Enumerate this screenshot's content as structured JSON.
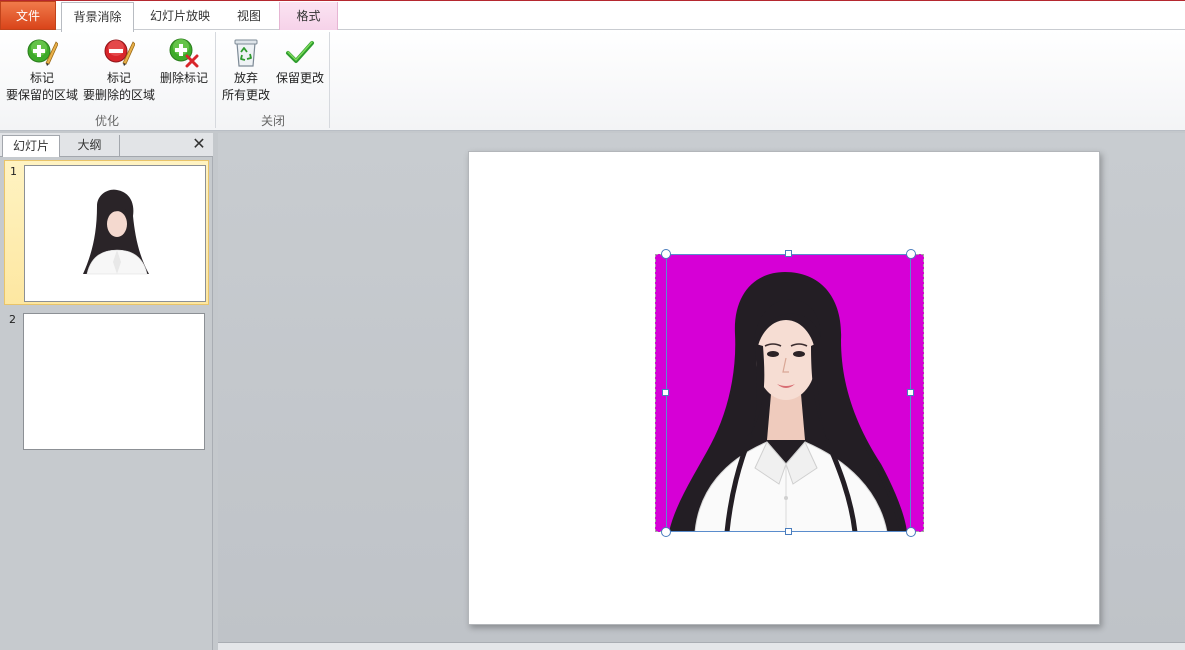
{
  "tabs": {
    "file": "文件",
    "background_removal": "背景消除",
    "slideshow": "幻灯片放映",
    "view": "视图",
    "format": "格式"
  },
  "ribbon": {
    "refine_group": {
      "label": "优化",
      "mark_keep": {
        "line1": "标记",
        "line2": "要保留的区域",
        "icon": "plus-pencil-icon"
      },
      "mark_remove": {
        "line1": "标记",
        "line2": "要删除的区域",
        "icon": "minus-pencil-icon"
      },
      "delete_mark": {
        "line1": "删除标记",
        "icon": "plus-x-icon"
      }
    },
    "close_group": {
      "label": "关闭",
      "discard": {
        "line1": "放弃",
        "line2": "所有更改",
        "icon": "recycle-bin-icon"
      },
      "keep": {
        "line1": "保留更改",
        "icon": "checkmark-icon"
      }
    }
  },
  "left_pane": {
    "tab_slides": "幻灯片",
    "tab_outline": "大纲",
    "close_glyph": "✕",
    "slides": [
      {
        "number": "1",
        "selected": true
      },
      {
        "number": "2",
        "selected": false
      }
    ]
  },
  "canvas": {
    "removal_highlight_color": "#d600d6"
  }
}
